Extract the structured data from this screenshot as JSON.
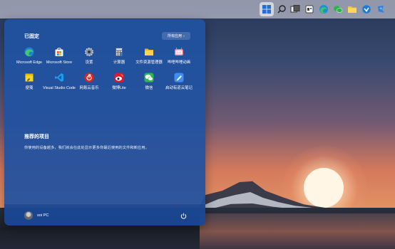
{
  "taskbar": {
    "icons": [
      "start",
      "search",
      "task-view",
      "widgets",
      "edge",
      "wechat",
      "file-explorer",
      "settings-store",
      "feishu"
    ]
  },
  "start_menu": {
    "pinned_title": "已固定",
    "all_apps_label": "所有应用",
    "pinned_apps": [
      {
        "label": "Microsoft Edge",
        "icon": "edge-icon"
      },
      {
        "label": "Microsoft Store",
        "icon": "store-icon"
      },
      {
        "label": "设置",
        "icon": "settings-icon"
      },
      {
        "label": "计算器",
        "icon": "calculator-icon"
      },
      {
        "label": "文件资源管理器",
        "icon": "folder-icon"
      },
      {
        "label": "哔哩哔哩动画",
        "icon": "bilibili-icon"
      },
      {
        "label": "便笺",
        "icon": "sticky-notes-icon"
      },
      {
        "label": "Visual Studio Code",
        "icon": "vscode-icon"
      },
      {
        "label": "网易云音乐",
        "icon": "netease-music-icon"
      },
      {
        "label": "微博Lite",
        "icon": "weibo-icon"
      },
      {
        "label": "微信",
        "icon": "wechat-icon"
      },
      {
        "label": "启动有道云笔记",
        "icon": "youdao-note-icon"
      }
    ],
    "recommended_title": "推荐的项目",
    "recommended_desc": "你使用的设备越多，我们就会在此处显示更多你最近使用的文件和新应用。",
    "user_name": "soi PC"
  },
  "colors": {
    "start_bg": "#2052a0",
    "accent": "#0067c0"
  }
}
